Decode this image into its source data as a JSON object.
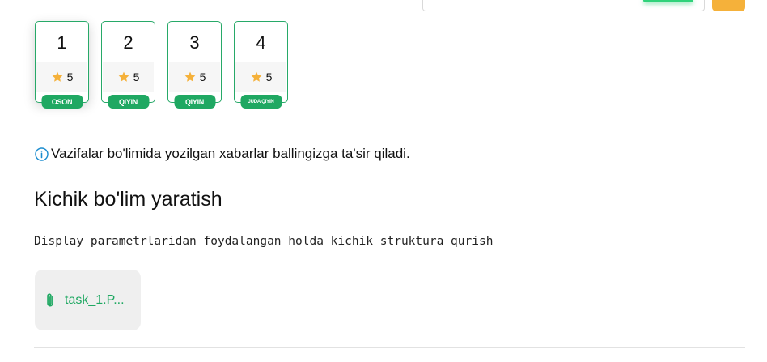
{
  "colors": {
    "brand_green": "#1fa862",
    "card_border": "#27a968",
    "star": "#f5b13a",
    "info": "#1a8ccf"
  },
  "tasks": [
    {
      "number": "1",
      "rating": "5",
      "difficulty": "OSON",
      "icon": "star-icon"
    },
    {
      "number": "2",
      "rating": "5",
      "difficulty": "QIYIN",
      "icon": "star-icon"
    },
    {
      "number": "3",
      "rating": "5",
      "difficulty": "QIYIN",
      "icon": "star-icon"
    },
    {
      "number": "4",
      "rating": "5",
      "difficulty": "JUDA QIYIN",
      "icon": "star-icon"
    }
  ],
  "notice": {
    "icon": "info-icon",
    "text": "Vazifalar bo'limida yozilgan xabarlar ballingizga ta'sir qiladi."
  },
  "section": {
    "title": "Kichik bo'lim yaratish",
    "description": "Display parametrlaridan foydalangan holda kichik struktura qurish"
  },
  "attachment": {
    "icon": "paperclip-icon",
    "name": "task_1.P..."
  }
}
